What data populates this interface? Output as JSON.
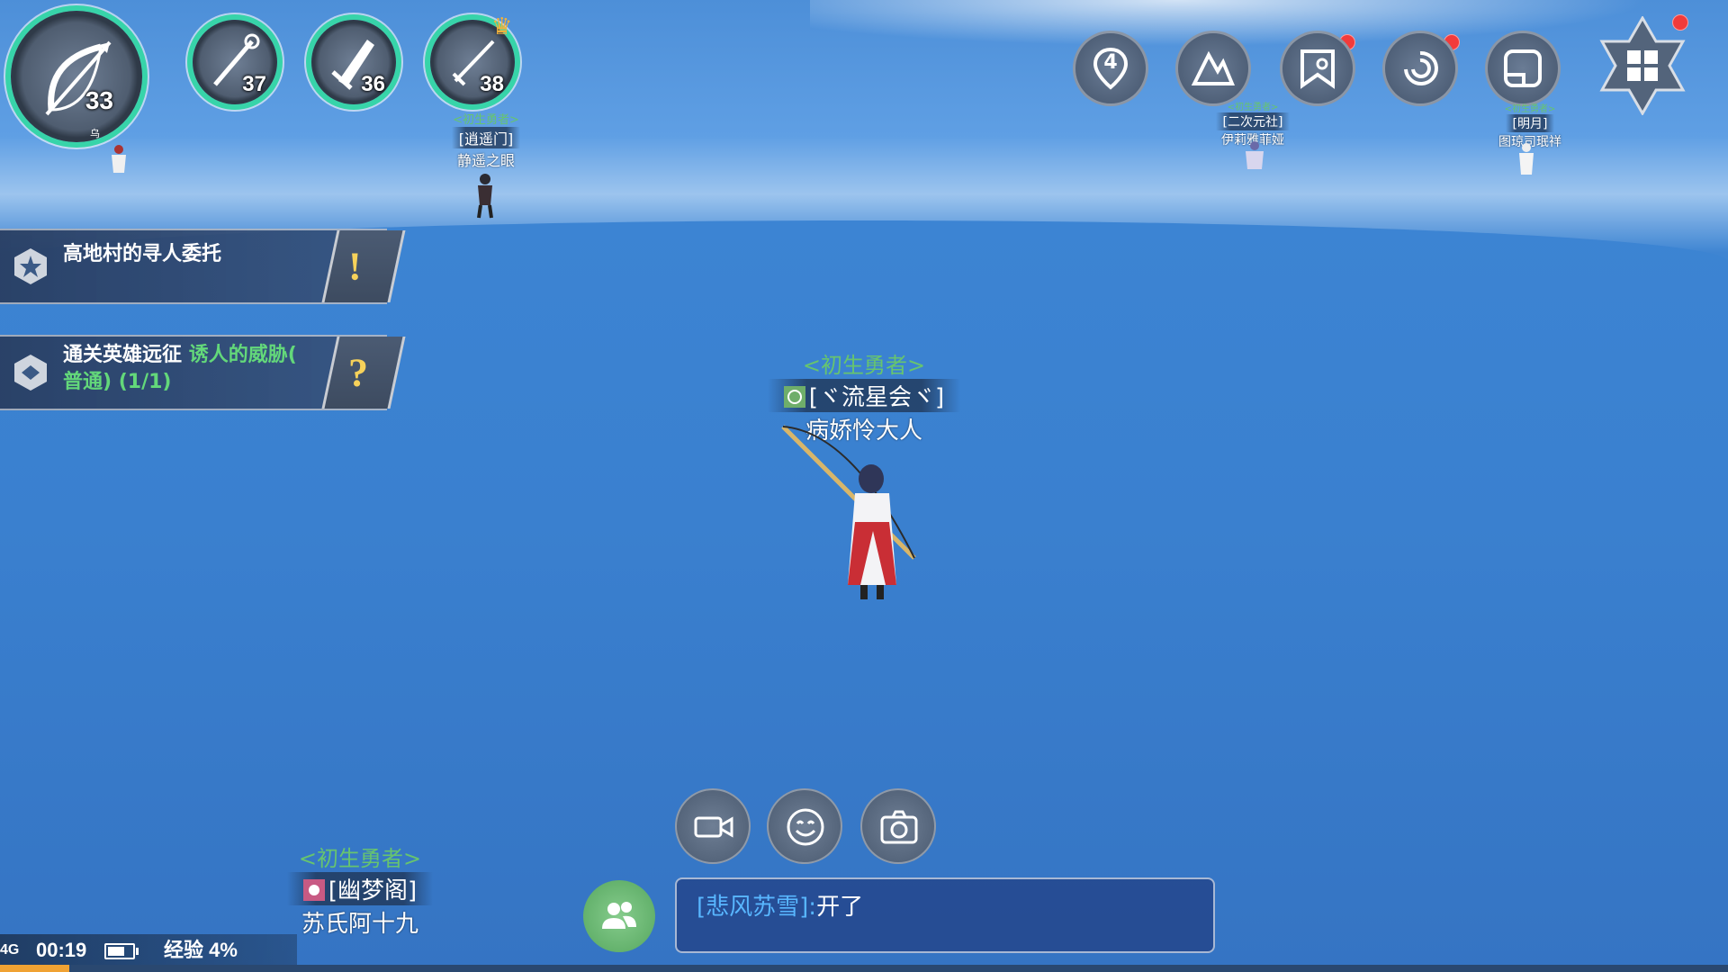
{
  "class_rings": [
    {
      "level": "33",
      "icon": "bow-icon"
    },
    {
      "level": "37",
      "icon": "staff-icon"
    },
    {
      "level": "36",
      "icon": "greatsword-icon"
    },
    {
      "level": "38",
      "icon": "sword-icon",
      "crowned": true
    }
  ],
  "top_buttons": {
    "map_count": "4",
    "badges": [
      "expedition",
      "adventure",
      "main-menu"
    ]
  },
  "quests": [
    {
      "title": "高地村的寻人委托",
      "marker": "!"
    },
    {
      "title": "通关英雄远征",
      "highlight": "诱人的威胁(",
      "detail": "普通) (1/1)",
      "marker": "?"
    }
  ],
  "players": {
    "main": {
      "rank": "<初生勇者>",
      "guild": "[ヾ流星会ヾ]",
      "name": "病娇怜大人"
    },
    "top_center": {
      "rank": "<初生勇者>",
      "guild": "[逍遥门]",
      "name": "静遥之眼"
    },
    "bottom_left": {
      "rank": "<初生勇者>",
      "guild": "[幽梦阁]",
      "name": "苏氏阿十九"
    },
    "far_1": {
      "rank": "<初生勇者>",
      "guild": "[二次元社]",
      "name": "伊莉雅菲娅"
    },
    "far_2": {
      "rank": "<初生勇者>",
      "guild": "[明月]",
      "name": "图琼司珉祥"
    },
    "far_left_label": "乌"
  },
  "chat": {
    "sender": "[悲风苏雪]:",
    "message": "开了"
  },
  "status": {
    "network": "4G",
    "time": "00:19",
    "experience": "经验 4%",
    "experience_fraction": 0.04
  },
  "colors": {
    "ring": "#37d4a9",
    "rank": "#67c46f",
    "chat_sender": "#58b6ff",
    "xp": "#f0a233"
  }
}
